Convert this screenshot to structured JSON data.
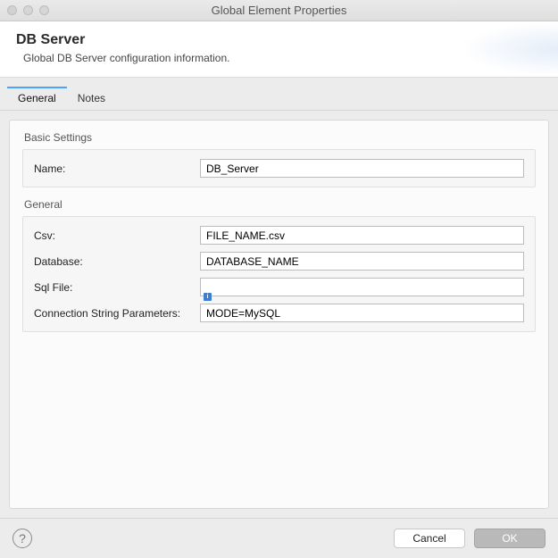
{
  "window": {
    "title": "Global Element Properties"
  },
  "header": {
    "title": "DB Server",
    "subtitle": "Global DB Server configuration information."
  },
  "tabs": [
    {
      "label": "General",
      "active": true
    },
    {
      "label": "Notes",
      "active": false
    }
  ],
  "groups": {
    "basic": {
      "label": "Basic Settings",
      "fields": {
        "name": {
          "label": "Name:",
          "value": "DB_Server"
        }
      }
    },
    "general": {
      "label": "General",
      "fields": {
        "csv": {
          "label": "Csv:",
          "value": "FILE_NAME.csv"
        },
        "database": {
          "label": "Database:",
          "value": "DATABASE_NAME"
        },
        "sqlFile": {
          "label": "Sql File:",
          "value": ""
        },
        "connStr": {
          "label": "Connection String Parameters:",
          "value": "MODE=MySQL"
        }
      }
    }
  },
  "footer": {
    "help": "?",
    "cancel": "Cancel",
    "ok": "OK"
  }
}
